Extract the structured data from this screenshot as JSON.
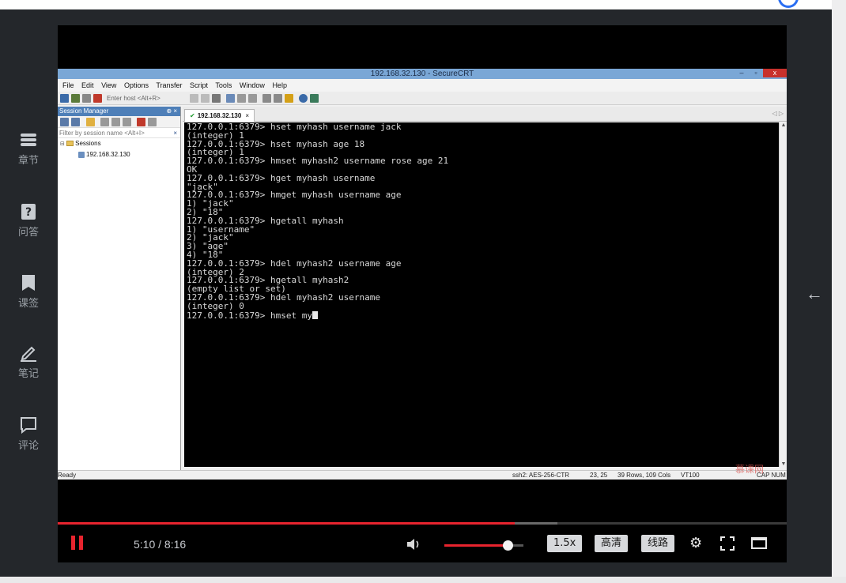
{
  "sidebar": {
    "items": [
      {
        "label": "章节",
        "icon": "chapters-icon"
      },
      {
        "label": "问答",
        "icon": "question-icon"
      },
      {
        "label": "课签",
        "icon": "bookmark-icon"
      },
      {
        "label": "笔记",
        "icon": "pen-icon"
      },
      {
        "label": "评论",
        "icon": "comment-icon"
      }
    ]
  },
  "crt": {
    "window_title": "192.168.32.130 - SecureCRT",
    "window_controls": {
      "minimize": "–",
      "maximize": "▫",
      "close": "x"
    },
    "menu": [
      "File",
      "Edit",
      "View",
      "Options",
      "Transfer",
      "Script",
      "Tools",
      "Window",
      "Help"
    ],
    "host_placeholder": "Enter host <Alt+R>",
    "session_manager": {
      "title": "Session Manager",
      "controls": "⊕ ×",
      "filter_placeholder": "Filter by session name <Alt+I>",
      "filter_clear": "×",
      "root": "Sessions",
      "session": "192.168.32.130"
    },
    "tab": {
      "label": "192.168.32.130",
      "close": "×",
      "arrows": "◁ ▷"
    },
    "terminal_lines": [
      "127.0.0.1:6379> hset myhash username jack",
      "(integer) 1",
      "127.0.0.1:6379> hset myhash age 18",
      "(integer) 1",
      "127.0.0.1:6379> hmset myhash2 username rose age 21",
      "OK",
      "127.0.0.1:6379> hget myhash username",
      "\"jack\"",
      "127.0.0.1:6379> hmget myhash username age",
      "1) \"jack\"",
      "2) \"18\"",
      "127.0.0.1:6379> hgetall myhash",
      "1) \"username\"",
      "2) \"jack\"",
      "3) \"age\"",
      "4) \"18\"",
      "127.0.0.1:6379> hdel myhash2 username age",
      "(integer) 2",
      "127.0.0.1:6379> hgetall myhash2",
      "(empty list or set)",
      "127.0.0.1:6379> hdel myhash2 username",
      "(integer) 0"
    ],
    "terminal_input_line": "127.0.0.1:6379> hmset my",
    "status": {
      "ready": "Ready",
      "cipher": "ssh2: AES-256-CTR",
      "cursor_pos": "23, 25",
      "size": "39 Rows, 109 Cols",
      "term": "VT100",
      "keys": "CAP NUM"
    },
    "watermark": "慕课网"
  },
  "player": {
    "time": "5:10 / 8:16",
    "progress": 0.627,
    "buffered": 0.685,
    "volume": 0.8,
    "speed_label": "1.5x",
    "quality_label": "高清",
    "line_label": "线路",
    "accent_color": "#e8242e"
  }
}
